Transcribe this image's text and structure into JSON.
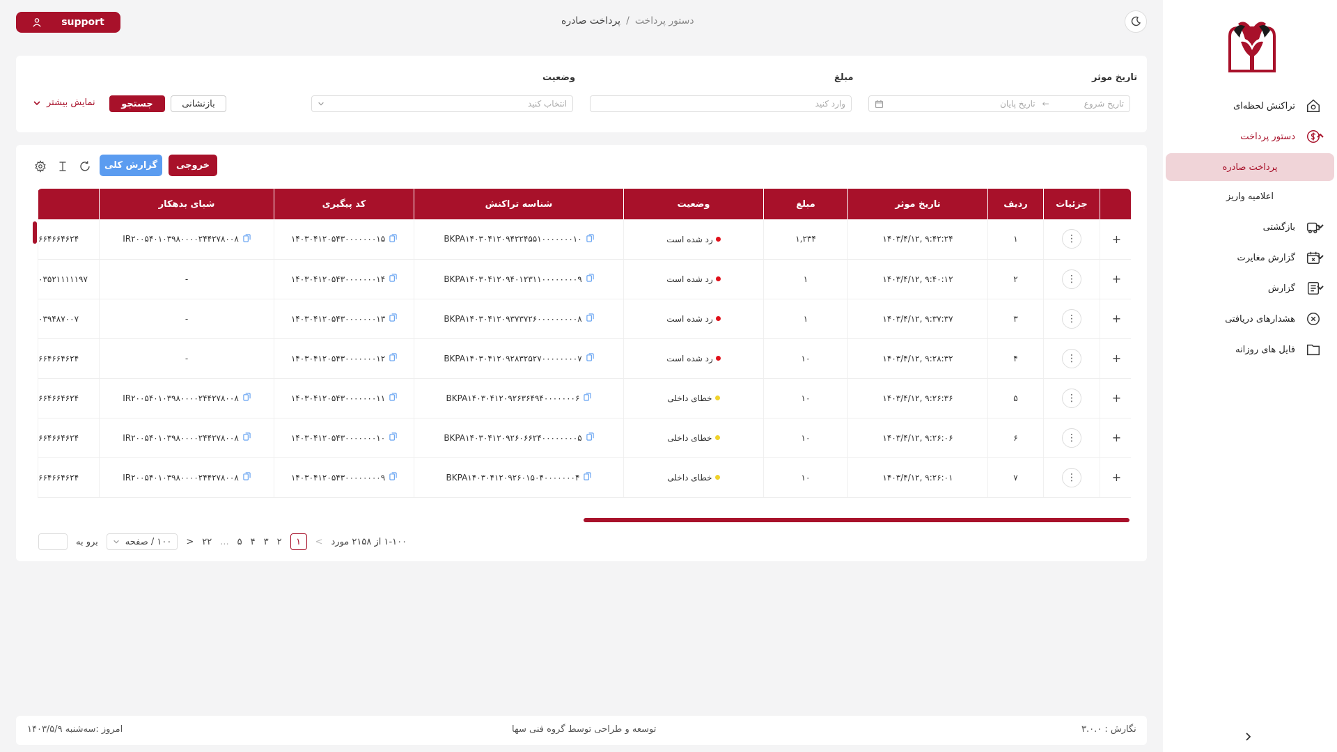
{
  "header": {
    "support_label": "support",
    "breadcrumb": {
      "parent": "دستور پرداخت",
      "separator": "/",
      "current": "پرداخت صادره"
    }
  },
  "sidebar": {
    "items": [
      {
        "label": "تراکنش لحظه‌ای",
        "icon": "home-icon"
      },
      {
        "label": "دستور پرداخت",
        "icon": "dollar-icon",
        "expanded": true
      },
      {
        "label": "بازگشتی",
        "icon": "car-return-icon"
      },
      {
        "label": "گزارش مغایرت",
        "icon": "calendar-x-icon"
      },
      {
        "label": "گزارش",
        "icon": "report-icon"
      },
      {
        "label": "هشدارهای دریافتی",
        "icon": "alert-x-icon"
      },
      {
        "label": "فایل های روزانه",
        "icon": "folder-icon"
      }
    ],
    "subitems": [
      {
        "label": "پرداخت صادره",
        "active": true
      },
      {
        "label": "اعلامیه واریز",
        "active": false
      }
    ]
  },
  "filters": {
    "date_label": "تاریخ موثر",
    "date_start_placeholder": "تاریخ شروع",
    "date_end_placeholder": "تاریخ پایان",
    "amount_label": "مبلغ",
    "amount_placeholder": "وارد کنید",
    "status_label": "وضعیت",
    "status_placeholder": "انتخاب کنید",
    "reset_label": "بازنشانی",
    "search_label": "جستجو",
    "show_more_label": "نمایش بیشتر"
  },
  "toolbar": {
    "export_label": "خروجی",
    "report_label": "گزارش کلی"
  },
  "table": {
    "columns": [
      "جزئیات",
      "ردیف",
      "تاریخ موثر",
      "مبلغ",
      "وضعیت",
      "شناسه تراکنش",
      "کد پیگیری",
      "شبای بدهکار",
      ""
    ],
    "rows": [
      {
        "row": "۱",
        "date": "۱۴۰۳/۴/۱۲, ۹:۴۲:۲۴",
        "amount": "۱,۲۳۴",
        "status": "رد شده است",
        "status_color": "red",
        "txid": "BKPA۱۴۰۳۰۴۱۲۰۹۴۲۲۴۵۵۱۰۰۰۰۰۰۰۱۰",
        "tracking": "۱۴۰۳۰۴۱۲۰۵۴۳۰۰۰۰۰۰۰۱۵",
        "iban": "IR۲۰۰۵۴۰۱۰۳۹۸۰۰۰۰۲۴۴۲۷۸۰۰۸",
        "extra": "۶۶۴۶۶۴۶۲۴"
      },
      {
        "row": "۲",
        "date": "۱۴۰۳/۴/۱۲, ۹:۴۰:۱۲",
        "amount": "۱",
        "status": "رد شده است",
        "status_color": "red",
        "txid": "BKPA۱۴۰۳۰۴۱۲۰۹۴۰۱۲۳۱۱۰۰۰۰۰۰۰۰۹",
        "tracking": "۱۴۰۳۰۴۱۲۰۵۴۳۰۰۰۰۰۰۰۱۴",
        "iban": "-",
        "extra": "۰۳۵۲۱۱۱۱۱۹۷"
      },
      {
        "row": "۳",
        "date": "۱۴۰۳/۴/۱۲, ۹:۳۷:۳۷",
        "amount": "۱",
        "status": "رد شده است",
        "status_color": "red",
        "txid": "BKPA۱۴۰۳۰۴۱۲۰۹۳۷۳۷۲۶۰۰۰۰۰۰۰۰۰۸",
        "tracking": "۱۴۰۳۰۴۱۲۰۵۴۳۰۰۰۰۰۰۰۱۳",
        "iban": "-",
        "extra": "۰۳۹۴۸۷۰۰۷"
      },
      {
        "row": "۴",
        "date": "۱۴۰۳/۴/۱۲, ۹:۲۸:۳۲",
        "amount": "۱۰",
        "status": "رد شده است",
        "status_color": "red",
        "txid": "BKPA۱۴۰۳۰۴۱۲۰۹۲۸۳۲۵۲۷۰۰۰۰۰۰۰۰۷",
        "tracking": "۱۴۰۳۰۴۱۲۰۵۴۳۰۰۰۰۰۰۰۱۲",
        "iban": "-",
        "extra": "۶۶۴۶۶۴۶۲۴"
      },
      {
        "row": "۵",
        "date": "۱۴۰۳/۴/۱۲, ۹:۲۶:۳۶",
        "amount": "۱۰",
        "status": "خطای داخلی",
        "status_color": "yellow",
        "txid": "BKPA۱۴۰۳۰۴۱۲۰۹۲۶۳۶۴۹۴۰۰۰۰۰۰۰۶",
        "tracking": "۱۴۰۳۰۴۱۲۰۵۴۳۰۰۰۰۰۰۰۱۱",
        "iban": "IR۲۰۰۵۴۰۱۰۳۹۸۰۰۰۰۲۴۴۲۷۸۰۰۸",
        "extra": "۶۶۴۶۶۴۶۲۴"
      },
      {
        "row": "۶",
        "date": "۱۴۰۳/۴/۱۲, ۹:۲۶:۰۶",
        "amount": "۱۰",
        "status": "خطای داخلی",
        "status_color": "yellow",
        "txid": "BKPA۱۴۰۳۰۴۱۲۰۹۲۶۰۶۶۲۴۰۰۰۰۰۰۰۰۵",
        "tracking": "۱۴۰۳۰۴۱۲۰۵۴۳۰۰۰۰۰۰۰۱۰",
        "iban": "IR۲۰۰۵۴۰۱۰۳۹۸۰۰۰۰۲۴۴۲۷۸۰۰۸",
        "extra": "۶۶۴۶۶۴۶۲۴"
      },
      {
        "row": "۷",
        "date": "۱۴۰۳/۴/۱۲, ۹:۲۶:۰۱",
        "amount": "۱۰",
        "status": "خطای داخلی",
        "status_color": "yellow",
        "txid": "BKPA۱۴۰۳۰۴۱۲۰۹۲۶۰۱۵۰۴۰۰۰۰۰۰۰۴",
        "tracking": "۱۴۰۳۰۴۱۲۰۵۴۳۰۰۰۰۰۰۰۰۹",
        "iban": "IR۲۰۰۵۴۰۱۰۳۹۸۰۰۰۰۲۴۴۲۷۸۰۰۸",
        "extra": "۶۶۴۶۶۴۶۲۴"
      }
    ]
  },
  "pagination": {
    "range_text": "۱-۱۰۰ از ۲۱۵۸ مورد",
    "pages": [
      "۱",
      "۲",
      "۳",
      "۴",
      "۵",
      "...",
      "۲۲"
    ],
    "active_page": "۱",
    "page_size": "۱۰۰ / صفحه",
    "goto_label": "برو به"
  },
  "footer": {
    "version": "نگارش : ۳.۰.۰",
    "credit": "توسعه و طراحی توسط گروه فنی سها",
    "today": "امروز :سه‌شنبه ۱۴۰۳/۵/۹"
  },
  "colors": {
    "primary": "#a8112a",
    "accent_blue": "#5b9cf0",
    "status_red": "#e0101a",
    "status_yellow": "#f0d22c"
  }
}
